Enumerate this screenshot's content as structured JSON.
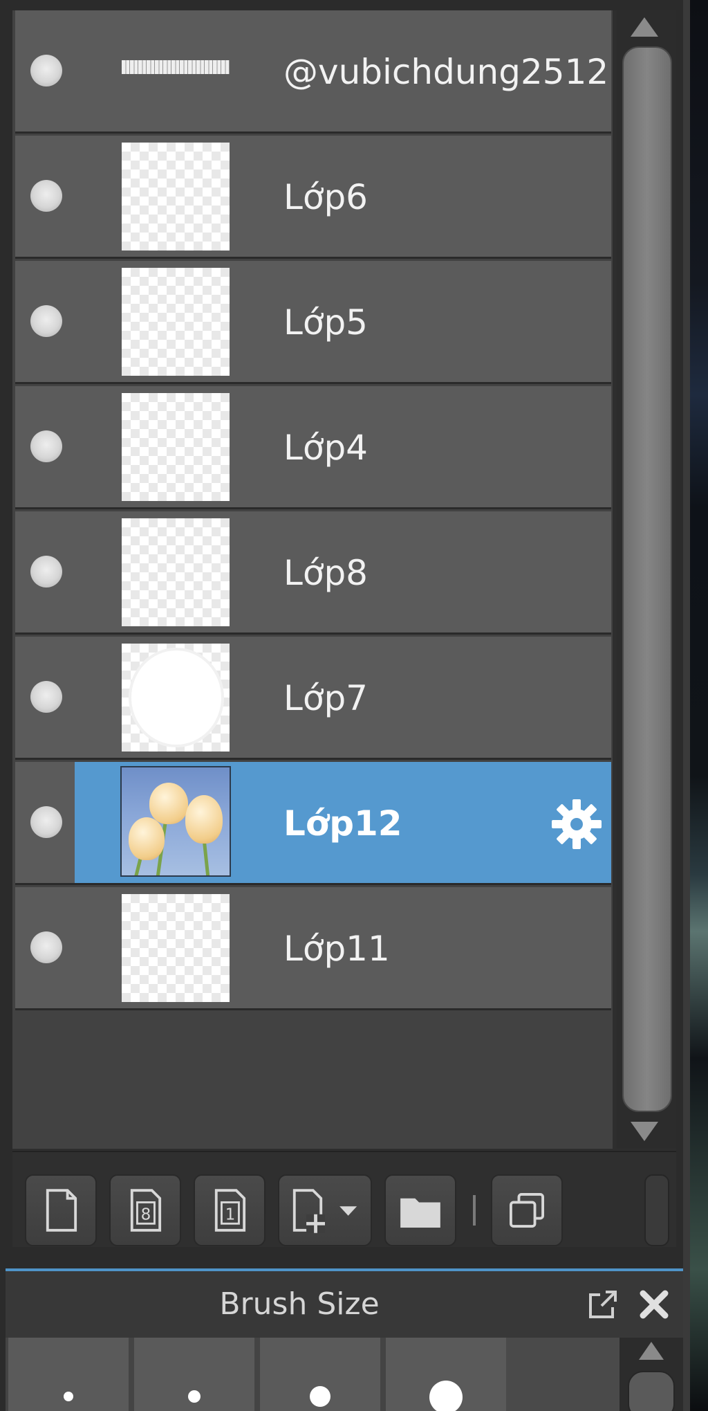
{
  "layers": [
    {
      "name": "@vubichdung2512",
      "thumb": "text-banner",
      "selected": false
    },
    {
      "name": "Lớp6",
      "thumb": "transparent",
      "selected": false
    },
    {
      "name": "Lớp5",
      "thumb": "transparent",
      "selected": false
    },
    {
      "name": "Lớp4",
      "thumb": "transparent",
      "selected": false
    },
    {
      "name": "Lớp8",
      "thumb": "transparent",
      "selected": false
    },
    {
      "name": "Lớp7",
      "thumb": "white-circle",
      "selected": false
    },
    {
      "name": "Lớp12",
      "thumb": "tulip-photo",
      "selected": true
    },
    {
      "name": "Lớp11",
      "thumb": "transparent",
      "selected": false
    }
  ],
  "toolbar": {
    "buttons": [
      {
        "icon": "new-layer-icon"
      },
      {
        "icon": "new-8bit-layer-icon"
      },
      {
        "icon": "new-1bit-layer-icon"
      },
      {
        "icon": "add-layer-dropdown-icon"
      },
      {
        "icon": "folder-icon"
      },
      {
        "icon": "duplicate-layer-icon"
      }
    ]
  },
  "brush_panel": {
    "title": "Brush Size",
    "sizes": [
      1,
      2,
      3,
      4
    ]
  },
  "colors": {
    "selected_row": "#5599cf",
    "row": "#5b5b5b",
    "accent_line": "#4f94c8"
  }
}
